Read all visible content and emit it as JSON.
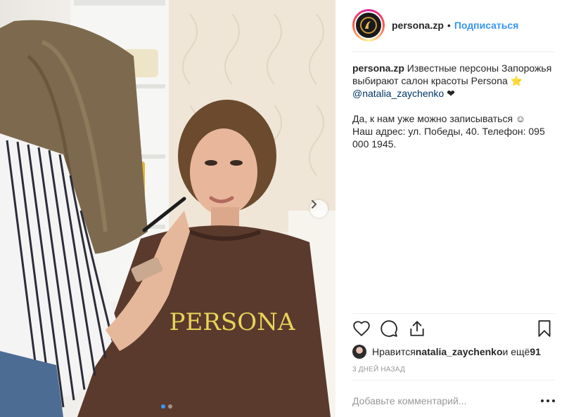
{
  "post": {
    "username": "persona.zp",
    "separator": "•",
    "follow_label": "Подписаться",
    "caption_user": "persona.zp",
    "caption_text": " Известные персоны Запорожья выбирают салон красоты Persona ⭐",
    "caption_mention": "@natalia_zaychenko",
    "caption_heart": " ❤",
    "caption_para2": "Да, к нам уже можно записываться ☺",
    "caption_para3": "Наш адрес: ул. Победы, 40. Телефон: 095 000 1945.",
    "likes_prefix": "Нравится ",
    "likes_user": "natalia_zaychenko",
    "likes_mid": " и ещё ",
    "likes_count": "91",
    "timestamp": "3 дней назад",
    "comment_placeholder": "Добавьте комментарий...",
    "photo_cape_text": "PERSONA"
  },
  "carousel": {
    "current": 1,
    "total": 2
  },
  "colors": {
    "link": "#3897f0",
    "mention": "#003569",
    "cape": "#5a3a2c",
    "cape_logo": "#e8d35a"
  },
  "icons": [
    "heart-icon",
    "comment-icon",
    "share-icon",
    "bookmark-icon",
    "chevron-right-icon",
    "more-options-icon"
  ]
}
